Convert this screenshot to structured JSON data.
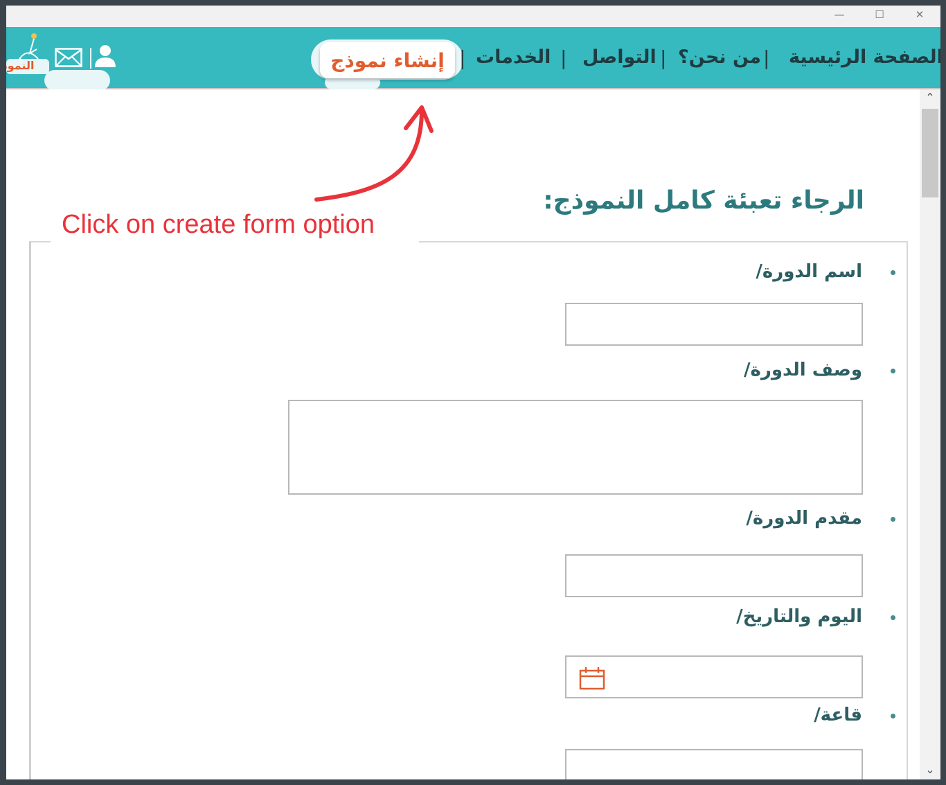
{
  "window": {
    "minimize_glyph": "—",
    "maximize_glyph": "☐",
    "close_glyph": "✕"
  },
  "nav": {
    "home": "الصفحة الرئيسية",
    "about": "من نحن؟",
    "contact": "التواصل",
    "services": "الخدمات",
    "create_form": "إنشاء نموذج",
    "separator": "|",
    "logo_text": "النموذج",
    "icons": [
      "user-icon",
      "mail-icon",
      "logo-icon"
    ]
  },
  "annotation": {
    "text": "Click on create form option",
    "color": "#e8333a"
  },
  "form": {
    "heading": "الرجاء تعبئة كامل النموذج:",
    "fields": [
      {
        "label": "اسم الدورة/",
        "type": "text",
        "value": ""
      },
      {
        "label": "وصف الدورة/",
        "type": "textarea",
        "value": ""
      },
      {
        "label": "مقدم الدورة/",
        "type": "text",
        "value": ""
      },
      {
        "label": "اليوم والتاريخ/",
        "type": "date",
        "value": ""
      },
      {
        "label": "قاعة/",
        "type": "text",
        "value": ""
      }
    ]
  },
  "colors": {
    "navbar": "#36b9bf",
    "accent": "#e15c2e",
    "heading": "#2c7a7e"
  }
}
